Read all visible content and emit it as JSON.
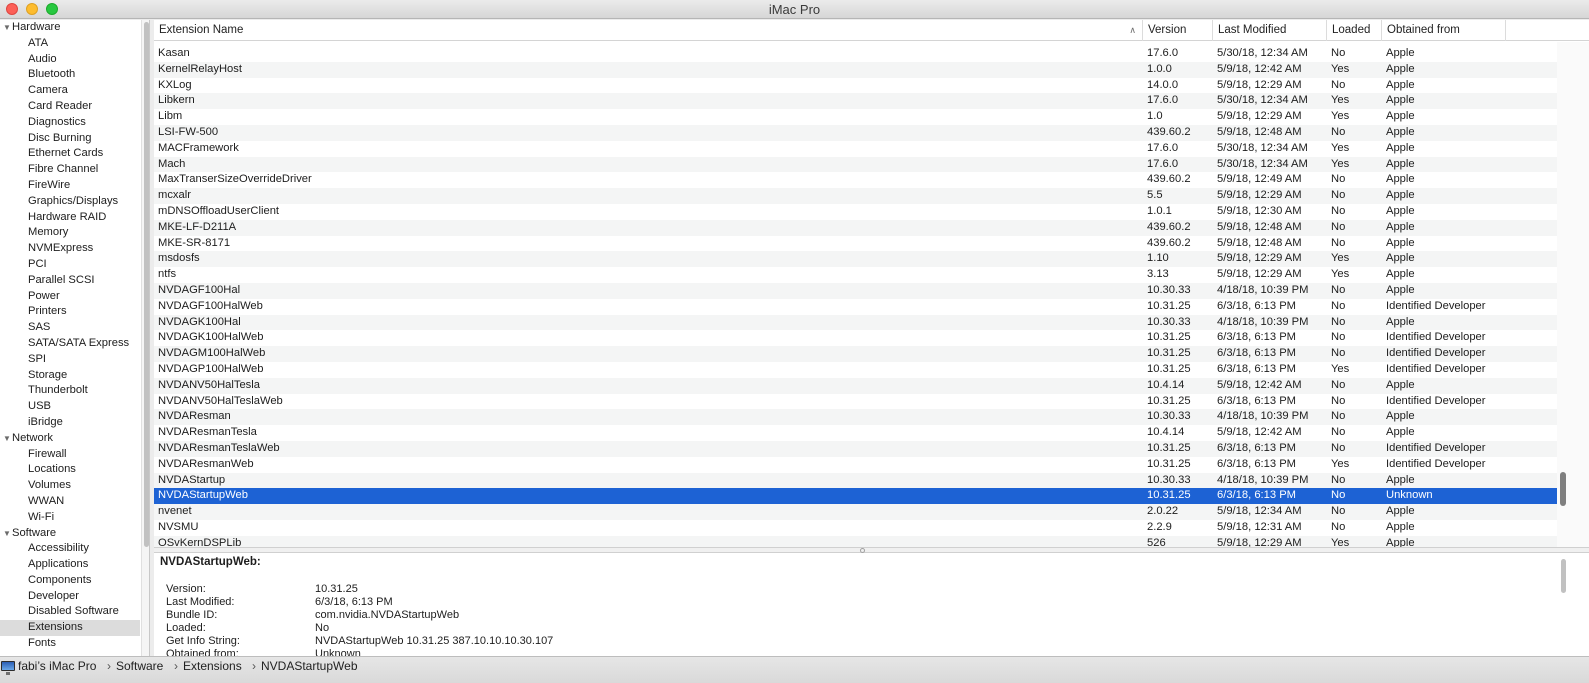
{
  "window": {
    "title": "iMac Pro"
  },
  "sidebar": {
    "categories": [
      {
        "label": "Hardware",
        "items": [
          "ATA",
          "Audio",
          "Bluetooth",
          "Camera",
          "Card Reader",
          "Diagnostics",
          "Disc Burning",
          "Ethernet Cards",
          "Fibre Channel",
          "FireWire",
          "Graphics/Displays",
          "Hardware RAID",
          "Memory",
          "NVMExpress",
          "PCI",
          "Parallel SCSI",
          "Power",
          "Printers",
          "SAS",
          "SATA/SATA Express",
          "SPI",
          "Storage",
          "Thunderbolt",
          "USB",
          "iBridge"
        ]
      },
      {
        "label": "Network",
        "items": [
          "Firewall",
          "Locations",
          "Volumes",
          "WWAN",
          "Wi-Fi"
        ]
      },
      {
        "label": "Software",
        "items": [
          "Accessibility",
          "Applications",
          "Components",
          "Developer",
          "Disabled Software",
          "Extensions",
          "Fonts"
        ]
      }
    ],
    "selected": "Extensions"
  },
  "table": {
    "columns": {
      "name": "Extension Name",
      "version": "Version",
      "modified": "Last Modified",
      "loaded": "Loaded",
      "obtained": "Obtained from"
    },
    "rows": [
      [
        "Kasan",
        "17.6.0",
        "5/30/18, 12:34 AM",
        "No",
        "Apple"
      ],
      [
        "KernelRelayHost",
        "1.0.0",
        "5/9/18, 12:42 AM",
        "Yes",
        "Apple"
      ],
      [
        "KXLog",
        "14.0.0",
        "5/9/18, 12:29 AM",
        "No",
        "Apple"
      ],
      [
        "Libkern",
        "17.6.0",
        "5/30/18, 12:34 AM",
        "Yes",
        "Apple"
      ],
      [
        "Libm",
        "1.0",
        "5/9/18, 12:29 AM",
        "Yes",
        "Apple"
      ],
      [
        "LSI-FW-500",
        "439.60.2",
        "5/9/18, 12:48 AM",
        "No",
        "Apple"
      ],
      [
        "MACFramework",
        "17.6.0",
        "5/30/18, 12:34 AM",
        "Yes",
        "Apple"
      ],
      [
        "Mach",
        "17.6.0",
        "5/30/18, 12:34 AM",
        "Yes",
        "Apple"
      ],
      [
        "MaxTranserSizeOverrideDriver",
        "439.60.2",
        "5/9/18, 12:49 AM",
        "No",
        "Apple"
      ],
      [
        "mcxalr",
        "5.5",
        "5/9/18, 12:29 AM",
        "No",
        "Apple"
      ],
      [
        "mDNSOffloadUserClient",
        "1.0.1",
        "5/9/18, 12:30 AM",
        "No",
        "Apple"
      ],
      [
        "MKE-LF-D211A",
        "439.60.2",
        "5/9/18, 12:48 AM",
        "No",
        "Apple"
      ],
      [
        "MKE-SR-8171",
        "439.60.2",
        "5/9/18, 12:48 AM",
        "No",
        "Apple"
      ],
      [
        "msdosfs",
        "1.10",
        "5/9/18, 12:29 AM",
        "Yes",
        "Apple"
      ],
      [
        "ntfs",
        "3.13",
        "5/9/18, 12:29 AM",
        "Yes",
        "Apple"
      ],
      [
        "NVDAGF100Hal",
        "10.30.33",
        "4/18/18, 10:39 PM",
        "No",
        "Apple"
      ],
      [
        "NVDAGF100HalWeb",
        "10.31.25",
        "6/3/18, 6:13 PM",
        "No",
        "Identified Developer"
      ],
      [
        "NVDAGK100Hal",
        "10.30.33",
        "4/18/18, 10:39 PM",
        "No",
        "Apple"
      ],
      [
        "NVDAGK100HalWeb",
        "10.31.25",
        "6/3/18, 6:13 PM",
        "No",
        "Identified Developer"
      ],
      [
        "NVDAGM100HalWeb",
        "10.31.25",
        "6/3/18, 6:13 PM",
        "No",
        "Identified Developer"
      ],
      [
        "NVDAGP100HalWeb",
        "10.31.25",
        "6/3/18, 6:13 PM",
        "Yes",
        "Identified Developer"
      ],
      [
        "NVDANV50HalTesla",
        "10.4.14",
        "5/9/18, 12:42 AM",
        "No",
        "Apple"
      ],
      [
        "NVDANV50HalTeslaWeb",
        "10.31.25",
        "6/3/18, 6:13 PM",
        "No",
        "Identified Developer"
      ],
      [
        "NVDAResman",
        "10.30.33",
        "4/18/18, 10:39 PM",
        "No",
        "Apple"
      ],
      [
        "NVDAResmanTesla",
        "10.4.14",
        "5/9/18, 12:42 AM",
        "No",
        "Apple"
      ],
      [
        "NVDAResmanTeslaWeb",
        "10.31.25",
        "6/3/18, 6:13 PM",
        "No",
        "Identified Developer"
      ],
      [
        "NVDAResmanWeb",
        "10.31.25",
        "6/3/18, 6:13 PM",
        "Yes",
        "Identified Developer"
      ],
      [
        "NVDAStartup",
        "10.30.33",
        "4/18/18, 10:39 PM",
        "No",
        "Apple"
      ],
      [
        "NVDAStartupWeb",
        "10.31.25",
        "6/3/18, 6:13 PM",
        "No",
        "Unknown"
      ],
      [
        "nvenet",
        "2.0.22",
        "5/9/18, 12:34 AM",
        "No",
        "Apple"
      ],
      [
        "NVSMU",
        "2.2.9",
        "5/9/18, 12:31 AM",
        "No",
        "Apple"
      ],
      [
        "OSvKernDSPLib",
        "526",
        "5/9/18, 12:29 AM",
        "Yes",
        "Apple"
      ]
    ],
    "selected_index": 28
  },
  "detail": {
    "title": "NVDAStartupWeb:",
    "fields": [
      {
        "key": "Version:",
        "value": "10.31.25"
      },
      {
        "key": "Last Modified:",
        "value": "6/3/18, 6:13 PM"
      },
      {
        "key": "Bundle ID:",
        "value": "com.nvidia.NVDAStartupWeb"
      },
      {
        "key": "Loaded:",
        "value": "No"
      },
      {
        "key": "Get Info String:",
        "value": "NVDAStartupWeb 10.31.25 387.10.10.10.30.107"
      },
      {
        "key": "Obtained from:",
        "value": "Unknown"
      }
    ]
  },
  "breadcrumb": {
    "computer": "fabi’s iMac Pro",
    "section": "Software",
    "page": "Extensions",
    "item": "NVDAStartupWeb"
  },
  "colors": {
    "selection": "#1d62d4",
    "sidebar_selection": "#dcdcdc"
  }
}
